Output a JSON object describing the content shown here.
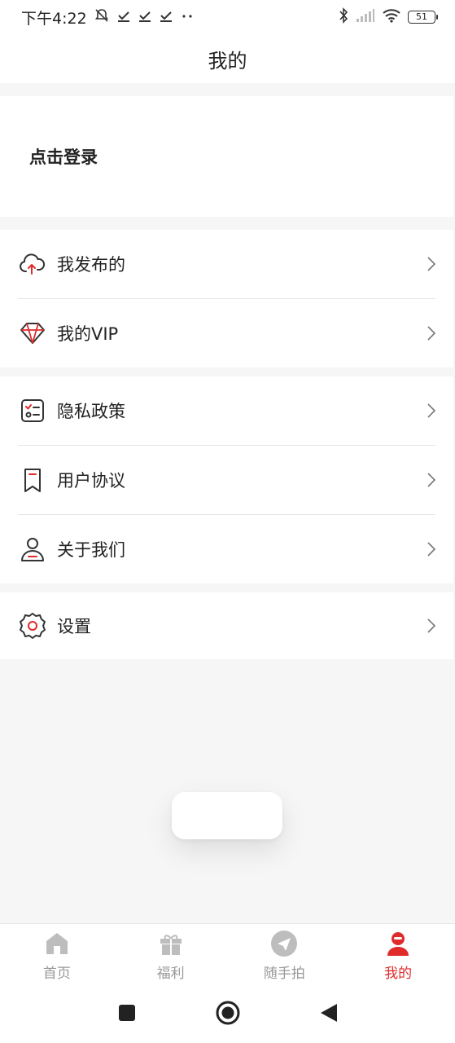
{
  "status_bar": {
    "time": "下午4:22",
    "battery": "51",
    "icons": [
      "mute-bell-icon",
      "check-icon",
      "check-icon",
      "check-icon",
      "more-dots-icon",
      "bluetooth-icon",
      "signal-icon",
      "wifi-icon",
      "battery-icon"
    ]
  },
  "header": {
    "title": "我的"
  },
  "login": {
    "label": "点击登录"
  },
  "menu_groups": [
    {
      "items": [
        {
          "label": "我发布的",
          "icon": "cloud-upload-icon"
        },
        {
          "label": "我的VIP",
          "icon": "diamond-icon"
        }
      ]
    },
    {
      "items": [
        {
          "label": "隐私政策",
          "icon": "checklist-icon"
        },
        {
          "label": "用户协议",
          "icon": "bookmark-icon"
        },
        {
          "label": "关于我们",
          "icon": "person-icon"
        }
      ]
    },
    {
      "items": [
        {
          "label": "设置",
          "icon": "gear-icon"
        }
      ]
    }
  ],
  "bottom_nav": [
    {
      "label": "首页",
      "icon": "home-icon",
      "active": false
    },
    {
      "label": "福利",
      "icon": "gift-icon",
      "active": false
    },
    {
      "label": "随手拍",
      "icon": "send-icon",
      "active": false
    },
    {
      "label": "我的",
      "icon": "user-icon",
      "active": true
    }
  ],
  "colors": {
    "accent": "#e02b2b",
    "inactive": "#999999",
    "background": "#f6f6f6"
  }
}
